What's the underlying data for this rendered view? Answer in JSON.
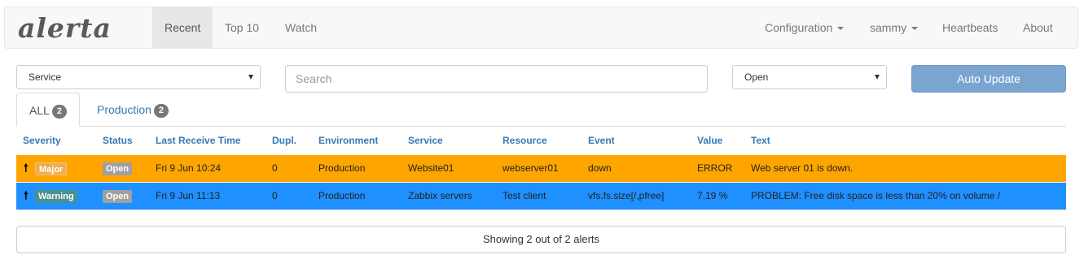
{
  "brand": {
    "logo_text": "alerta"
  },
  "nav": {
    "left": [
      {
        "label": "Recent",
        "active": true
      },
      {
        "label": "Top 10"
      },
      {
        "label": "Watch"
      }
    ],
    "right": [
      {
        "label": "Configuration",
        "dropdown": true
      },
      {
        "label": "sammy",
        "dropdown": true
      },
      {
        "label": "Heartbeats"
      },
      {
        "label": "About"
      }
    ]
  },
  "filters": {
    "group_by": {
      "selected": "Service"
    },
    "search": {
      "placeholder": "Search",
      "value": ""
    },
    "status": {
      "selected": "Open"
    },
    "auto_update_label": "Auto Update"
  },
  "tabs": [
    {
      "label": "ALL",
      "count": "2",
      "active": true
    },
    {
      "label": "Production",
      "count": "2"
    }
  ],
  "table": {
    "headers": [
      "Severity",
      "Status",
      "Last Receive Time",
      "Dupl.",
      "Environment",
      "Service",
      "Resource",
      "Event",
      "Value",
      "Text"
    ],
    "rows": [
      {
        "arrow": "🠕",
        "severity": "Major",
        "status": "Open",
        "last_receive_time": "Fri 9 Jun 10:24",
        "dupl": "0",
        "environment": "Production",
        "service": "Website01",
        "resource": "webserver01",
        "event": "down",
        "value": "ERROR",
        "text": "Web server 01 is down."
      },
      {
        "arrow": "🠕",
        "severity": "Warning",
        "status": "Open",
        "last_receive_time": "Fri 9 Jun 11:13",
        "dupl": "0",
        "environment": "Production",
        "service": "Zabbix servers",
        "resource": "Test client",
        "event": "vfs.fs.size[/,pfree]",
        "value": "7.19 %",
        "text": "PROBLEM: Free disk space is less than 20% on volume /"
      }
    ]
  },
  "footer": {
    "summary": "Showing 2 out of 2 alerts"
  },
  "colors": {
    "major_row": "#ffa500",
    "warning_row": "#1e90ff",
    "header_link": "#337ab7",
    "auto_update_button": "#7aa5d0"
  }
}
